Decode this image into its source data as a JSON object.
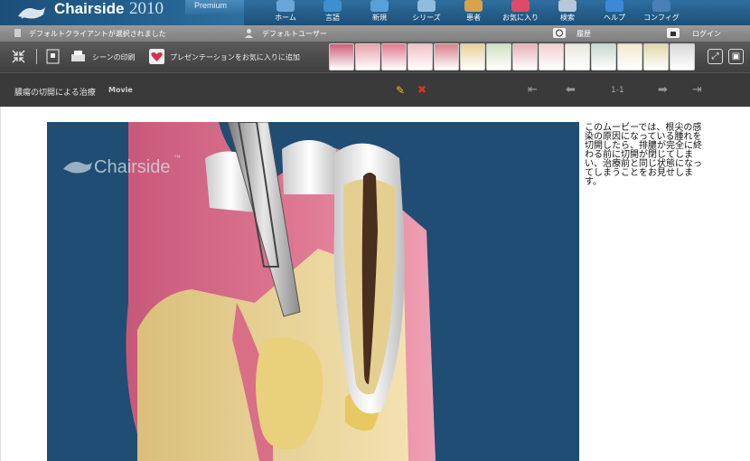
{
  "brand": {
    "name": "Chairside",
    "trademark": "®",
    "year": "2010",
    "edition": "Premium"
  },
  "toolbar": [
    {
      "id": "home",
      "label": "ホーム",
      "color": "#6aa6d8"
    },
    {
      "id": "words",
      "label": "言語",
      "color": "#3d8fd0"
    },
    {
      "id": "new",
      "label": "新規",
      "color": "#5aa0d8"
    },
    {
      "id": "series",
      "label": "シリーズ",
      "color": "#8fbde0"
    },
    {
      "id": "patient",
      "label": "患者",
      "color": "#d8a34a"
    },
    {
      "id": "favorites",
      "label": "お気に入り",
      "color": "#e04a6a"
    },
    {
      "id": "search",
      "label": "検索",
      "color": "#b8c8d8"
    },
    {
      "id": "help",
      "label": "ヘルプ",
      "color": "#3a8ad8"
    },
    {
      "id": "config",
      "label": "コンフィグ",
      "color": "#4a7fb8"
    }
  ],
  "status": {
    "client": "デフォルトクライアントが選択されました",
    "user": "デフォルトユーザー",
    "history": "履歴",
    "login": "ログイン"
  },
  "actions": {
    "print": "シーンの印刷",
    "add_favorite": "プレゼンテーションをお気に入りに追加"
  },
  "thumbnails": [
    "tools",
    "gum",
    "teeth-open",
    "smile",
    "lips",
    "roots",
    "bridge",
    "crowns",
    "gingiva",
    "implant",
    "xray",
    "brace",
    "implant2",
    "kit"
  ],
  "media": {
    "title": "膿瘍の切開による治療",
    "type": "Movie",
    "page": "1-1",
    "watermark": "Chairside",
    "watermark_tm": "™"
  },
  "description": "このムービーでは、根尖の感染の原因になっている腫れを切開したら、排膿が完全に終わる前に切開が閉じてしまい、治療前と同じ状態になってしまうことをお見せします。",
  "colors": {
    "accent": "#1f4d73",
    "gum": "#d96f86",
    "bone": "#e8d5a0"
  }
}
